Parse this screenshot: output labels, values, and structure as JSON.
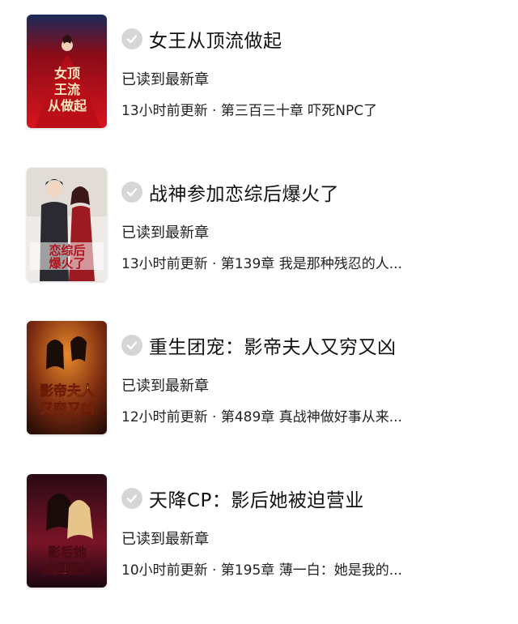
{
  "books": [
    {
      "title": "女王从顶流做起",
      "status": "已读到最新章",
      "update": "13小时前更新 · 第三百三十章 吓死NPC了",
      "cover_text": "女王从顶流做起",
      "cover_color": "#c8101a"
    },
    {
      "title": "战神参加恋综后爆火了",
      "status": "已读到最新章",
      "update": "13小时前更新 · 第139章 我是那种残忍的人...",
      "cover_text": "恋综后爆火了",
      "cover_color": "#e9e4df"
    },
    {
      "title": "重生团宠：影帝夫人又穷又凶",
      "status": "已读到最新章",
      "update": "12小时前更新 · 第489章 真战神做好事从来...",
      "cover_text": "影帝夫人又穷又凶",
      "cover_color": "#3a1a0e"
    },
    {
      "title": "天降CP：影后她被迫营业",
      "status": "已读到最新章",
      "update": "10小时前更新 · 第195章 薄一白：她是我的...",
      "cover_text": "影后她被迫营业",
      "cover_color": "#5a1020"
    }
  ],
  "icons": {
    "read_status": "checkmark-icon"
  }
}
